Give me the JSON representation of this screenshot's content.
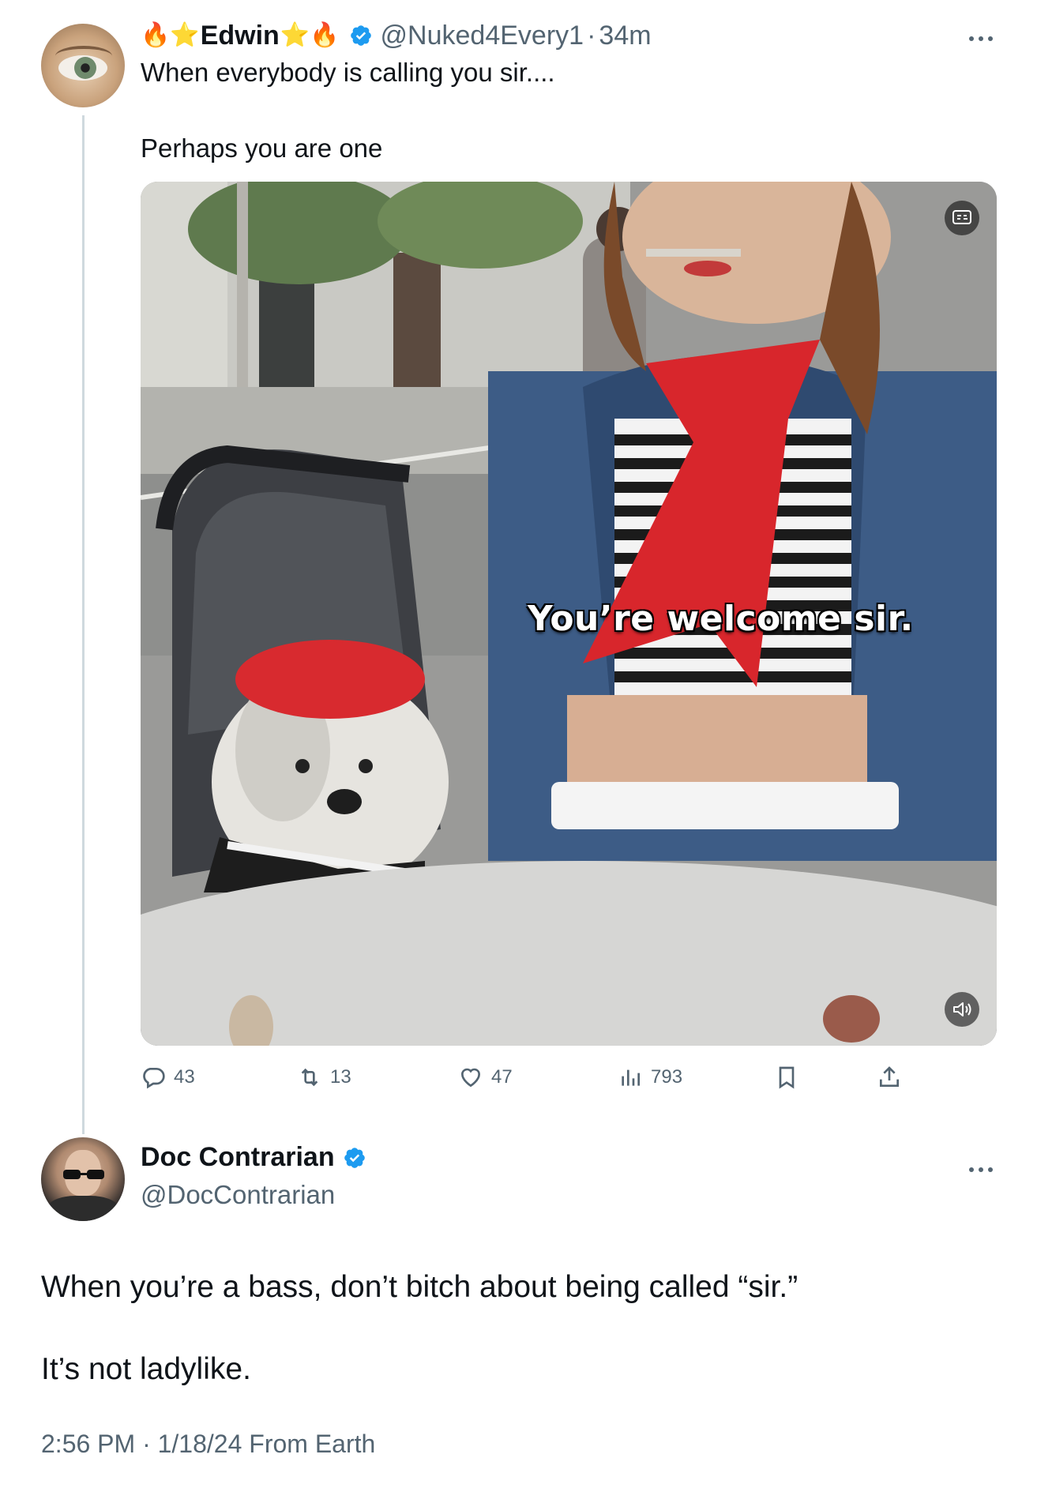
{
  "quoted_tweet": {
    "author": {
      "display_name": "Edwin",
      "emoji_prefix": "🔥⭐",
      "emoji_suffix": "⭐🔥",
      "handle": "@Nuked4Every1",
      "verified": true
    },
    "separator": "·",
    "time_ago": "34m",
    "text_line1": "When everybody is calling you sir....",
    "text_line2": "Perhaps you are one",
    "media": {
      "caption": "You’re welcome sir."
    },
    "actions": {
      "replies": "43",
      "reposts": "13",
      "likes": "47",
      "views": "793"
    }
  },
  "main_tweet": {
    "author": {
      "display_name": "Doc Contrarian",
      "handle": "@DocContrarian",
      "verified": true
    },
    "text": "When you’re a bass, don’t bitch about being called “sir.”\n\nIt’s not ladylike.",
    "meta": "2:56 PM · 1/18/24 From Earth"
  },
  "icons": {
    "more": "more-horizontal-icon",
    "verified": "verified-badge-icon",
    "reply": "reply-icon",
    "repost": "repost-icon",
    "like": "heart-icon",
    "views": "views-chart-icon",
    "bookmark": "bookmark-icon",
    "share": "share-icon",
    "captions": "captions-icon",
    "volume": "volume-icon"
  },
  "colors": {
    "verified_blue": "#1d9bf0",
    "secondary_text": "#536471",
    "thread_line": "#cfd9de"
  }
}
